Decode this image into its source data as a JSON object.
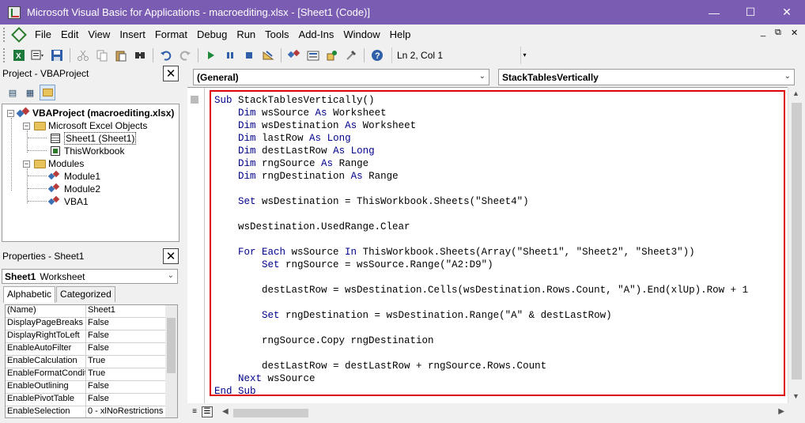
{
  "window": {
    "title": "Microsoft Visual Basic for Applications - macroediting.xlsx - [Sheet1 (Code)]",
    "minimize_glyph": "—",
    "maximize_glyph": "☐",
    "close_glyph": "✕"
  },
  "menu": {
    "items": [
      "File",
      "Edit",
      "View",
      "Insert",
      "Format",
      "Debug",
      "Run",
      "Tools",
      "Add-Ins",
      "Window",
      "Help"
    ],
    "mdi_min": "_",
    "mdi_restore": "⧉",
    "mdi_close": "✕"
  },
  "toolbar": {
    "position": "Ln 2, Col 1",
    "icons": [
      "excel-icon",
      "insert-module-icon",
      "save-icon",
      "cut-icon",
      "copy-icon",
      "paste-icon",
      "find-icon",
      "undo-icon",
      "redo-icon",
      "run-icon",
      "break-icon",
      "reset-icon",
      "design-mode-icon",
      "project-explorer-icon",
      "properties-icon",
      "object-browser-icon",
      "toolbox-icon",
      "help-icon"
    ]
  },
  "project_panel": {
    "title": "Project - VBAProject",
    "root": "VBAProject (macroediting.xlsx)",
    "excel_objects_folder": "Microsoft Excel Objects",
    "sheet1": "Sheet1 (Sheet1)",
    "thisworkbook": "ThisWorkbook",
    "modules_folder": "Modules",
    "modules": [
      "Module1",
      "Module2",
      "VBA1"
    ]
  },
  "properties_panel": {
    "title": "Properties - Sheet1",
    "object_name": "Sheet1",
    "object_type": "Worksheet",
    "tabs": [
      "Alphabetic",
      "Categorized"
    ],
    "rows": [
      {
        "name": "(Name)",
        "value": "Sheet1"
      },
      {
        "name": "DisplayPageBreaks",
        "value": "False"
      },
      {
        "name": "DisplayRightToLeft",
        "value": "False"
      },
      {
        "name": "EnableAutoFilter",
        "value": "False"
      },
      {
        "name": "EnableCalculation",
        "value": "True"
      },
      {
        "name": "EnableFormatConditi",
        "value": "True"
      },
      {
        "name": "EnableOutlining",
        "value": "False"
      },
      {
        "name": "EnablePivotTable",
        "value": "False"
      },
      {
        "name": "EnableSelection",
        "value": "0 - xlNoRestrictions"
      }
    ]
  },
  "code_window": {
    "object_combo": "(General)",
    "procedure_combo": "StackTablesVertically",
    "highlight_color": "#e0000a",
    "keyword_color": "#00008b",
    "lines": [
      [
        {
          "k": 1,
          "t": "Sub"
        },
        {
          "k": 0,
          "t": " StackTablesVertically()"
        }
      ],
      [
        {
          "k": 0,
          "t": "    "
        },
        {
          "k": 1,
          "t": "Dim"
        },
        {
          "k": 0,
          "t": " wsSource "
        },
        {
          "k": 1,
          "t": "As"
        },
        {
          "k": 0,
          "t": " Worksheet"
        }
      ],
      [
        {
          "k": 0,
          "t": "    "
        },
        {
          "k": 1,
          "t": "Dim"
        },
        {
          "k": 0,
          "t": " wsDestination "
        },
        {
          "k": 1,
          "t": "As"
        },
        {
          "k": 0,
          "t": " Worksheet"
        }
      ],
      [
        {
          "k": 0,
          "t": "    "
        },
        {
          "k": 1,
          "t": "Dim"
        },
        {
          "k": 0,
          "t": " lastRow "
        },
        {
          "k": 1,
          "t": "As"
        },
        {
          "k": 0,
          "t": " "
        },
        {
          "k": 1,
          "t": "Long"
        }
      ],
      [
        {
          "k": 0,
          "t": "    "
        },
        {
          "k": 1,
          "t": "Dim"
        },
        {
          "k": 0,
          "t": " destLastRow "
        },
        {
          "k": 1,
          "t": "As"
        },
        {
          "k": 0,
          "t": " "
        },
        {
          "k": 1,
          "t": "Long"
        }
      ],
      [
        {
          "k": 0,
          "t": "    "
        },
        {
          "k": 1,
          "t": "Dim"
        },
        {
          "k": 0,
          "t": " rngSource "
        },
        {
          "k": 1,
          "t": "As"
        },
        {
          "k": 0,
          "t": " Range"
        }
      ],
      [
        {
          "k": 0,
          "t": "    "
        },
        {
          "k": 1,
          "t": "Dim"
        },
        {
          "k": 0,
          "t": " rngDestination "
        },
        {
          "k": 1,
          "t": "As"
        },
        {
          "k": 0,
          "t": " Range"
        }
      ],
      [
        {
          "k": 0,
          "t": ""
        }
      ],
      [
        {
          "k": 0,
          "t": "    "
        },
        {
          "k": 1,
          "t": "Set"
        },
        {
          "k": 0,
          "t": " wsDestination = ThisWorkbook.Sheets(\"Sheet4\")"
        }
      ],
      [
        {
          "k": 0,
          "t": ""
        }
      ],
      [
        {
          "k": 0,
          "t": "    wsDestination.UsedRange.Clear"
        }
      ],
      [
        {
          "k": 0,
          "t": ""
        }
      ],
      [
        {
          "k": 0,
          "t": "    "
        },
        {
          "k": 1,
          "t": "For Each"
        },
        {
          "k": 0,
          "t": " wsSource "
        },
        {
          "k": 1,
          "t": "In"
        },
        {
          "k": 0,
          "t": " ThisWorkbook.Sheets(Array(\"Sheet1\", \"Sheet2\", \"Sheet3\"))"
        }
      ],
      [
        {
          "k": 0,
          "t": "        "
        },
        {
          "k": 1,
          "t": "Set"
        },
        {
          "k": 0,
          "t": " rngSource = wsSource.Range(\"A2:D9\")"
        }
      ],
      [
        {
          "k": 0,
          "t": ""
        }
      ],
      [
        {
          "k": 0,
          "t": "        destLastRow = wsDestination.Cells(wsDestination.Rows.Count, \"A\").End(xlUp).Row + 1"
        }
      ],
      [
        {
          "k": 0,
          "t": ""
        }
      ],
      [
        {
          "k": 0,
          "t": "        "
        },
        {
          "k": 1,
          "t": "Set"
        },
        {
          "k": 0,
          "t": " rngDestination = wsDestination.Range(\"A\" & destLastRow)"
        }
      ],
      [
        {
          "k": 0,
          "t": ""
        }
      ],
      [
        {
          "k": 0,
          "t": "        rngSource.Copy rngDestination"
        }
      ],
      [
        {
          "k": 0,
          "t": ""
        }
      ],
      [
        {
          "k": 0,
          "t": "        destLastRow = destLastRow + rngSource.Rows.Count"
        }
      ],
      [
        {
          "k": 0,
          "t": "    "
        },
        {
          "k": 1,
          "t": "Next"
        },
        {
          "k": 0,
          "t": " wsSource"
        }
      ],
      [
        {
          "k": 1,
          "t": "End Sub"
        }
      ]
    ]
  }
}
